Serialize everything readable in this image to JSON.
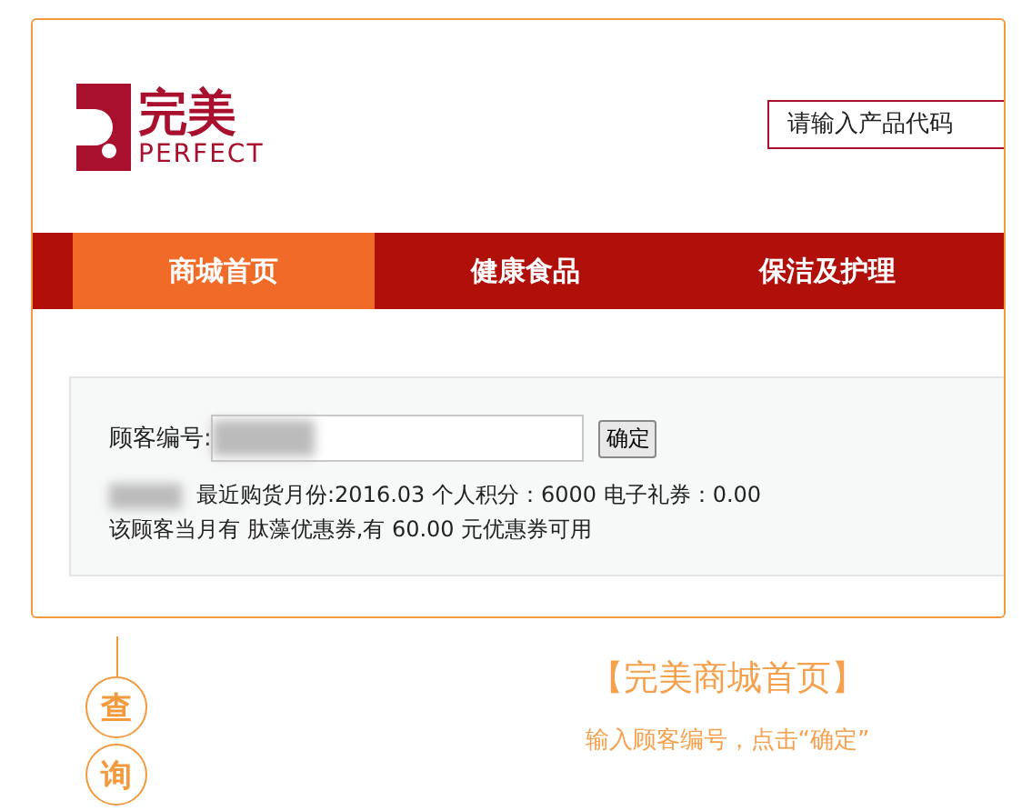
{
  "logo": {
    "name": "完美",
    "latin": "PERFECT"
  },
  "search": {
    "placeholder": "请输入产品代码"
  },
  "nav": [
    {
      "label": "商城首页",
      "selected": true
    },
    {
      "label": "健康食品",
      "selected": false
    },
    {
      "label": "保洁及护理",
      "selected": false
    }
  ],
  "query": {
    "label": "顾客编号:",
    "button": "确定",
    "summary": "最近购货月份:2016.03 个人积分：6000 电子礼券：0.00",
    "coupon": "该顾客当月有 肽藻优惠券,有 60.00 元优惠券可用"
  },
  "steps": [
    "查",
    "询"
  ],
  "caption": {
    "title": "【完美商城首页】",
    "hint": "输入顾客编号，点击“确定”"
  }
}
